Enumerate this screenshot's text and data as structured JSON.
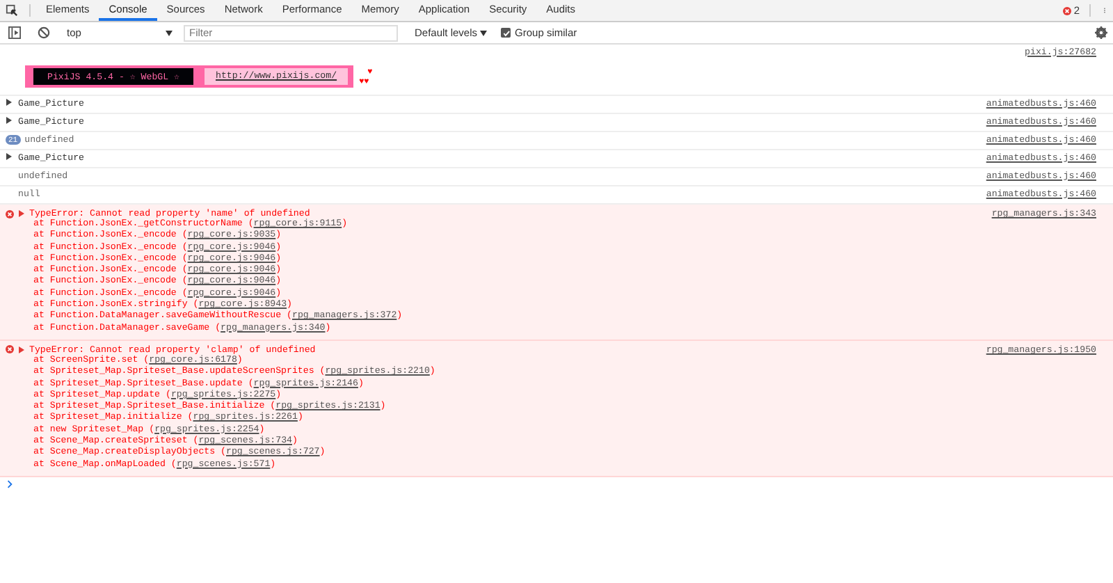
{
  "tabs": [
    {
      "label": "Elements",
      "selected": false
    },
    {
      "label": "Console",
      "selected": true
    },
    {
      "label": "Sources",
      "selected": false
    },
    {
      "label": "Network",
      "selected": false
    },
    {
      "label": "Performance",
      "selected": false
    },
    {
      "label": "Memory",
      "selected": false
    },
    {
      "label": "Application",
      "selected": false
    },
    {
      "label": "Security",
      "selected": false
    },
    {
      "label": "Audits",
      "selected": false
    }
  ],
  "error_count": "2",
  "toolbar": {
    "context": "top",
    "filter": {
      "placeholder": "Filter"
    },
    "levels": "Default levels",
    "group_similar": {
      "label": "Group similar",
      "checked": true
    }
  },
  "messages": [
    {
      "kind": "banner",
      "text": "PixiJS 4.5.4 - ☆ WebGL ☆",
      "url": "http://www.pixijs.com/",
      "hearts": [
        "♥",
        "♥♥"
      ],
      "source": "pixi.js:27682"
    },
    {
      "kind": "object",
      "text": "Game_Picture",
      "source": "animatedbusts.js:460"
    },
    {
      "kind": "object",
      "text": "Game_Picture",
      "source": "animatedbusts.js:460"
    },
    {
      "kind": "text",
      "count": "21",
      "text": "undefined",
      "source": "animatedbusts.js:460"
    },
    {
      "kind": "object",
      "text": "Game_Picture",
      "source": "animatedbusts.js:460"
    },
    {
      "kind": "text",
      "text": "undefined",
      "source": "animatedbusts.js:460"
    },
    {
      "kind": "text",
      "text": "null",
      "source": "animatedbusts.js:460"
    },
    {
      "kind": "error",
      "text": "TypeError: Cannot read property 'name' of undefined",
      "source": "rpg_managers.js:343",
      "stack": [
        {
          "text": "at Function.JsonEx._getConstructorName (",
          "link": "rpg_core.js:9115",
          "end": ")"
        },
        {
          "text": "at Function.JsonEx._encode (",
          "link": "rpg_core.js:9035",
          "end": ")"
        },
        {
          "text": "at Function.JsonEx._encode (",
          "link": "rpg_core.js:9046",
          "end": ")"
        },
        {
          "text": "at Function.JsonEx._encode (",
          "link": "rpg_core.js:9046",
          "end": ")"
        },
        {
          "text": "at Function.JsonEx._encode (",
          "link": "rpg_core.js:9046",
          "end": ")"
        },
        {
          "text": "at Function.JsonEx._encode (",
          "link": "rpg_core.js:9046",
          "end": ")"
        },
        {
          "text": "at Function.JsonEx._encode (",
          "link": "rpg_core.js:9046",
          "end": ")"
        },
        {
          "text": "at Function.JsonEx.stringify (",
          "link": "rpg_core.js:8943",
          "end": ")"
        },
        {
          "text": "at Function.DataManager.saveGameWithoutRescue (",
          "link": "rpg_managers.js:372",
          "end": ")"
        },
        {
          "text": "at Function.DataManager.saveGame (",
          "link": "rpg_managers.js:340",
          "end": ")"
        }
      ]
    },
    {
      "kind": "error",
      "text": "TypeError: Cannot read property 'clamp' of undefined",
      "source": "rpg_managers.js:1950",
      "stack": [
        {
          "text": "at ScreenSprite.set (",
          "link": "rpg_core.js:6178",
          "end": ")"
        },
        {
          "text": "at Spriteset_Map.Spriteset_Base.updateScreenSprites (",
          "link": "rpg_sprites.js:2210",
          "end": ")"
        },
        {
          "text": "at Spriteset_Map.Spriteset_Base.update (",
          "link": "rpg_sprites.js:2146",
          "end": ")"
        },
        {
          "text": "at Spriteset_Map.update (",
          "link": "rpg_sprites.js:2275",
          "end": ")"
        },
        {
          "text": "at Spriteset_Map.Spriteset_Base.initialize (",
          "link": "rpg_sprites.js:2131",
          "end": ")"
        },
        {
          "text": "at Spriteset_Map.initialize (",
          "link": "rpg_sprites.js:2261",
          "end": ")"
        },
        {
          "text": "at new Spriteset_Map (",
          "link": "rpg_sprites.js:2254",
          "end": ")"
        },
        {
          "text": "at Scene_Map.createSpriteset (",
          "link": "rpg_scenes.js:734",
          "end": ")"
        },
        {
          "text": "at Scene_Map.createDisplayObjects (",
          "link": "rpg_scenes.js:727",
          "end": ")"
        },
        {
          "text": "at Scene_Map.onMapLoaded (",
          "link": "rpg_scenes.js:571",
          "end": ")"
        }
      ]
    }
  ]
}
